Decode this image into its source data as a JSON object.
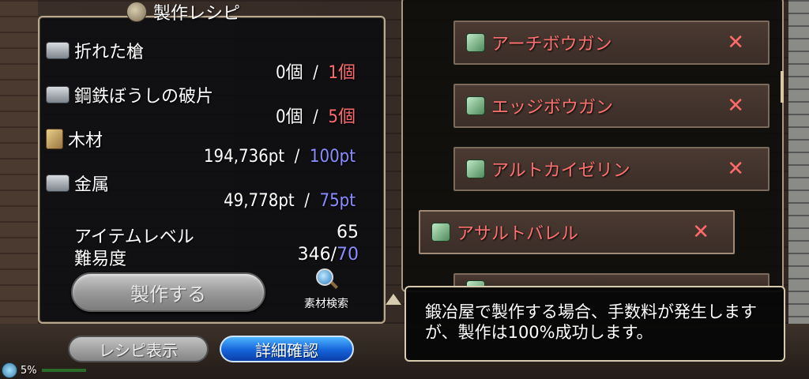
{
  "title": "製作レシピ",
  "materials": [
    {
      "name": "折れた槍",
      "have": "0個",
      "sep": "/",
      "need": "1個",
      "need_color": "red"
    },
    {
      "name": "鋼鉄ぼうしの破片",
      "have": "0個",
      "sep": "/",
      "need": "5個",
      "need_color": "red"
    },
    {
      "name": "木材",
      "have": "194,736pt",
      "sep": "/",
      "need": "100pt",
      "need_color": "blue"
    },
    {
      "name": "金属",
      "have": "49,778pt",
      "sep": "/",
      "need": "75pt",
      "need_color": "blue"
    }
  ],
  "item_level": {
    "label": "アイテムレベル",
    "value": "65"
  },
  "difficulty": {
    "label": "難易度",
    "value": "346",
    "slash": "/",
    "max": "70"
  },
  "craft_button": "製作する",
  "search_materials": "素材検索",
  "recipe_show_button": "レシピ表示",
  "detail_button": "詳細確認",
  "status": {
    "percent_text": "5%"
  },
  "recipes": [
    {
      "name": "アーチボウガン",
      "mark": "✕"
    },
    {
      "name": "エッジボウガン",
      "mark": "✕"
    },
    {
      "name": "アルトカイゼリン",
      "mark": "✕"
    },
    {
      "name": "アサルトバレル",
      "mark": "✕"
    }
  ],
  "message": "鍛冶屋で製作する場合、手数料が発生しますが、製作は100%成功します。",
  "colors": {
    "need_red": "#ff6a6a",
    "need_blue": "#8a8cff",
    "recipe_name": "#ff7070"
  }
}
